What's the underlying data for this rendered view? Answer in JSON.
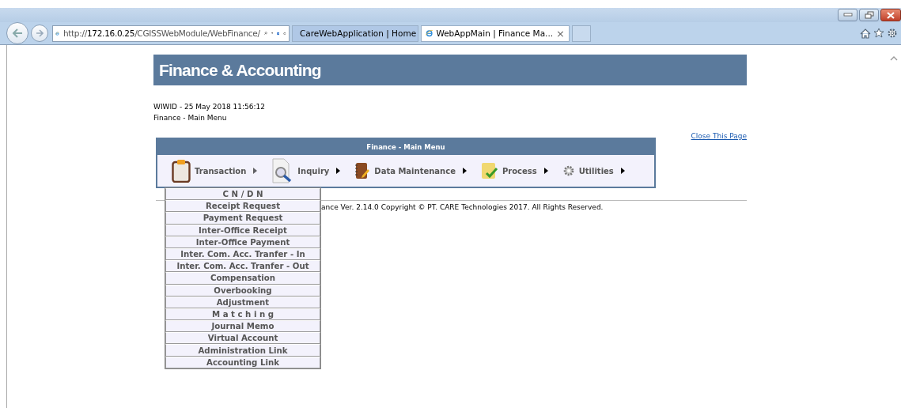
{
  "browser": {
    "address": {
      "prefix": "http://",
      "host": "172.16.0.25",
      "path": "/CGISSWebModule/WebFinance/"
    },
    "tabs": [
      {
        "label": "CareWebApplication | Home",
        "selected": false
      },
      {
        "label": "WebAppMain | Finance Ma...",
        "selected": true,
        "closable": true
      }
    ],
    "close_tab_glyph": "×"
  },
  "header": {
    "title": "Finance & Accounting"
  },
  "info": [
    "WIWID - 25 May 2018 11:56:12",
    "Finance - Main Menu"
  ],
  "close_link": "Close This Page",
  "menu": {
    "title": "Finance - Main Menu",
    "items": [
      {
        "label": "Transaction",
        "kind": "clipboard",
        "expanded": true
      },
      {
        "label": "Inquiry",
        "kind": "magnifier",
        "expanded": false
      },
      {
        "label": "Data Maintenance",
        "kind": "notebook",
        "expanded": false
      },
      {
        "label": "Process",
        "kind": "check",
        "expanded": false
      },
      {
        "label": "Utilities",
        "kind": "gear",
        "expanded": false
      }
    ]
  },
  "submenu": [
    "C N / D N",
    "Receipt Request",
    "Payment Request",
    "Inter-Office Receipt",
    "Inter-Office Payment",
    "Inter. Com. Acc. Tranfer - In",
    "Inter. Com. Acc. Tranfer - Out",
    "Compensation",
    "Overbooking",
    "Adjustment",
    "M a t c h i n g",
    "Journal Memo",
    "Virtual Account",
    "Administration Link",
    "Accounting Link"
  ],
  "footer": "ance Ver. 2.14.0 Copyright © PT. CARE Technologies 2017. All Rights Reserved."
}
